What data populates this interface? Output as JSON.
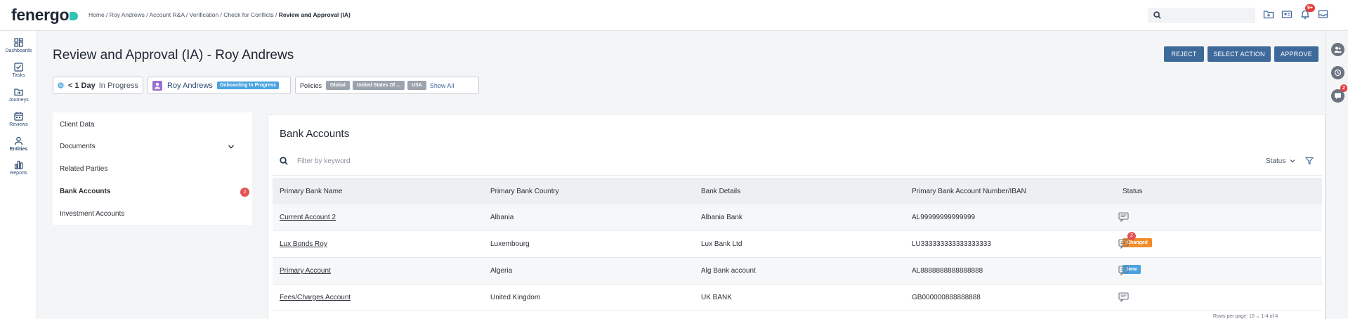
{
  "brand": {
    "name": "fenergo"
  },
  "breadcrumb": {
    "trail": "Home / Roy Andrews / Account R&A / Verification / Check for Conflicts / ",
    "current": "Review and Approval (IA)"
  },
  "topbar": {
    "notifications_badge": "9+"
  },
  "leftnav": {
    "items": [
      {
        "label": "Dashboards",
        "icon": "dashboard-icon"
      },
      {
        "label": "Tasks",
        "icon": "tasks-icon"
      },
      {
        "label": "Journeys",
        "icon": "journeys-icon"
      },
      {
        "label": "Reviews",
        "icon": "reviews-icon"
      },
      {
        "label": "Entities",
        "icon": "entities-icon"
      },
      {
        "label": "Reports",
        "icon": "reports-icon"
      }
    ]
  },
  "rightrail": {
    "comments_badge": "2"
  },
  "header": {
    "title": "Review and Approval (IA) - Roy Andrews",
    "buttons": {
      "reject": "REJECT",
      "select_action": "SELECT ACTION",
      "approve": "APPROVE"
    }
  },
  "chips": {
    "sla": {
      "time": "< 1 Day",
      "status": "In Progress"
    },
    "entity": {
      "name": "Roy Andrews",
      "tag": "Onboarding In Progress"
    },
    "policies": {
      "label": "Policies",
      "tags": [
        "Global",
        "United States Of ...",
        "USA"
      ],
      "show_all": "Show All"
    }
  },
  "sidemenu": {
    "items": [
      {
        "label": "Client Data"
      },
      {
        "label": "Documents"
      },
      {
        "label": "Related Parties"
      },
      {
        "label": "Bank Accounts",
        "badge": "2"
      },
      {
        "label": "Investment Accounts"
      }
    ]
  },
  "panel": {
    "title": "Bank Accounts",
    "filter_placeholder": "Filter by keyword",
    "status_filter": "Status",
    "columns": [
      "Primary Bank Name",
      "Primary Bank Country",
      "Bank Details",
      "Primary Bank Account Number/IBAN",
      "Status"
    ],
    "rows": [
      {
        "name": "Current Account 2",
        "country": "Albania",
        "details": "Albania Bank",
        "iban": "AL99999999999999",
        "status": ""
      },
      {
        "name": "Lux Bonds Roy",
        "country": "Luxembourg",
        "details": "Lux Bank Ltd",
        "iban": "LU333333333333333333",
        "status": "Changed",
        "comment_badge": "2"
      },
      {
        "name": "Primary Account",
        "country": "Algeria",
        "details": "Alg Bank account",
        "iban": "AL8888888888888888",
        "status": "New"
      },
      {
        "name": "Fees/Charges Account",
        "country": "United Kingdom",
        "details": "UK BANK",
        "iban": "GB000000888888888",
        "status": ""
      }
    ],
    "pager": "Rows per page: 10   ⌄   1-4 of 4"
  },
  "colors": {
    "primary": "#3e6a9b",
    "changed": "#f28c28",
    "new": "#4aa3e0",
    "badge": "#e55353"
  }
}
